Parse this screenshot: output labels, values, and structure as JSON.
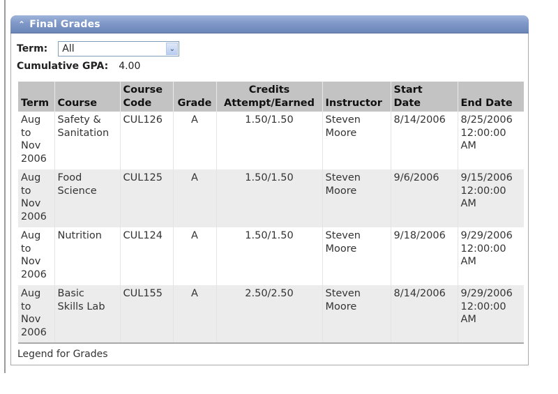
{
  "panel": {
    "title": "Final Grades",
    "collapse_icon": "double-chevron-up-icon",
    "colors": {
      "header": "#7f98c8",
      "table_header": "#c3c3c3",
      "alt_row": "#ececec"
    }
  },
  "filters": {
    "term_label": "Term:",
    "term_value": "All",
    "gpa_label": "Cumulative GPA:",
    "gpa_value": "4.00"
  },
  "table": {
    "headers": [
      {
        "line1": "",
        "line2": "Term"
      },
      {
        "line1": "",
        "line2": "Course"
      },
      {
        "line1": "Course",
        "line2": "Code"
      },
      {
        "line1": "",
        "line2": "Grade"
      },
      {
        "line1": "Credits",
        "line2": "Attempt/Earned"
      },
      {
        "line1": "",
        "line2": "Instructor"
      },
      {
        "line1": "Start",
        "line2": "Date"
      },
      {
        "line1": "",
        "line2": "End Date"
      }
    ],
    "rows": [
      {
        "term": [
          "Aug",
          "to",
          "Nov",
          "2006"
        ],
        "course": [
          "Safety &",
          "Sanitation"
        ],
        "code": "CUL126",
        "grade": "A",
        "credits": "1.50/1.50",
        "instructor": [
          "Steven",
          "Moore"
        ],
        "start": "8/14/2006",
        "end": [
          "8/25/2006",
          "12:00:00",
          "AM"
        ]
      },
      {
        "term": [
          "Aug",
          "to",
          "Nov",
          "2006"
        ],
        "course": [
          "Food",
          "Science"
        ],
        "code": "CUL125",
        "grade": "A",
        "credits": "1.50/1.50",
        "instructor": [
          "Steven",
          "Moore"
        ],
        "start": "9/6/2006",
        "end": [
          "9/15/2006",
          "12:00:00",
          "AM"
        ]
      },
      {
        "term": [
          "Aug",
          "to",
          "Nov",
          "2006"
        ],
        "course": [
          "Nutrition"
        ],
        "code": "CUL124",
        "grade": "A",
        "credits": "1.50/1.50",
        "instructor": [
          "Steven",
          "Moore"
        ],
        "start": "9/18/2006",
        "end": [
          "9/29/2006",
          "12:00:00",
          "AM"
        ]
      },
      {
        "term": [
          "Aug",
          "to",
          "Nov",
          "2006"
        ],
        "course": [
          "Basic",
          "Skills Lab"
        ],
        "code": "CUL155",
        "grade": "A",
        "credits": "2.50/2.50",
        "instructor": [
          "Steven",
          "Moore"
        ],
        "start": "8/14/2006",
        "end": [
          "9/29/2006",
          "12:00:00",
          "AM"
        ]
      }
    ]
  },
  "footer": {
    "legend_link": "Legend for Grades"
  }
}
